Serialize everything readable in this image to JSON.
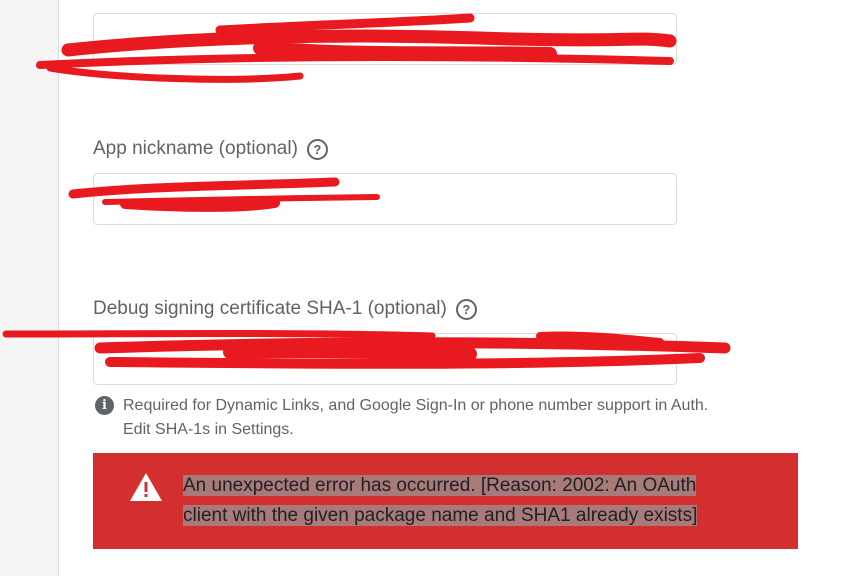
{
  "form": {
    "package_name": {
      "value": ""
    },
    "app_nickname": {
      "label": "App nickname (optional)",
      "help_icon": "help-circle-icon",
      "value": ""
    },
    "sha1": {
      "label": "Debug signing certificate SHA-1 (optional)",
      "help_icon": "help-circle-icon",
      "value": ""
    },
    "hint": {
      "icon": "info-icon",
      "line1": "Required for Dynamic Links, and Google Sign-In or phone number support in Auth.",
      "line2": "Edit SHA-1s in Settings."
    }
  },
  "error": {
    "icon": "warning-icon",
    "line1": "An unexpected error has occurred. [Reason: 2002: An OAuth",
    "line2": "client with the given package name and SHA1 already exists]",
    "background": "#d32f2f"
  },
  "redaction_color": "#e8191f"
}
